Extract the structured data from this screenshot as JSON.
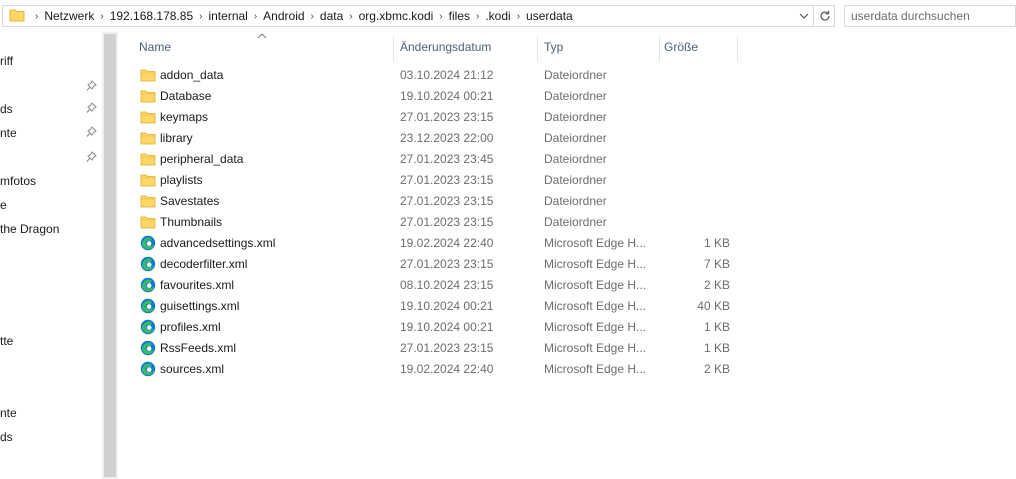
{
  "address_bar": {
    "path": [
      "Netzwerk",
      "192.168.178.85",
      "internal",
      "Android",
      "data",
      "org.xbmc.kodi",
      "files",
      ".kodi",
      "userdata"
    ]
  },
  "search": {
    "placeholder": "userdata durchsuchen"
  },
  "nav_pane": {
    "items": [
      {
        "label": "riff",
        "pinned": false
      },
      {
        "label": "",
        "pinned": true
      },
      {
        "label": "ds",
        "pinned": true
      },
      {
        "label": "nte",
        "pinned": true
      },
      {
        "label": "",
        "pinned": true
      },
      {
        "label": "mfotos",
        "pinned": false
      },
      {
        "label": "e",
        "pinned": false
      },
      {
        "label": "the Dragon",
        "pinned": false
      },
      {
        "label": "tte",
        "pinned": false
      },
      {
        "label": "nte",
        "pinned": false
      },
      {
        "label": "ds",
        "pinned": false
      }
    ]
  },
  "columns": {
    "name": "Name",
    "date": "Änderungsdatum",
    "type": "Typ",
    "size": "Größe",
    "sorted_by": "name"
  },
  "files": [
    {
      "name": "addon_data",
      "date": "03.10.2024 21:12",
      "type": "Dateiordner",
      "size": "",
      "icon": "folder-icon"
    },
    {
      "name": "Database",
      "date": "19.10.2024 00:21",
      "type": "Dateiordner",
      "size": "",
      "icon": "folder-icon"
    },
    {
      "name": "keymaps",
      "date": "27.01.2023 23:15",
      "type": "Dateiordner",
      "size": "",
      "icon": "folder-icon"
    },
    {
      "name": "library",
      "date": "23.12.2023 22:00",
      "type": "Dateiordner",
      "size": "",
      "icon": "folder-icon"
    },
    {
      "name": "peripheral_data",
      "date": "27.01.2023 23:45",
      "type": "Dateiordner",
      "size": "",
      "icon": "folder-icon"
    },
    {
      "name": "playlists",
      "date": "27.01.2023 23:15",
      "type": "Dateiordner",
      "size": "",
      "icon": "folder-icon"
    },
    {
      "name": "Savestates",
      "date": "27.01.2023 23:15",
      "type": "Dateiordner",
      "size": "",
      "icon": "folder-icon"
    },
    {
      "name": "Thumbnails",
      "date": "27.01.2023 23:15",
      "type": "Dateiordner",
      "size": "",
      "icon": "folder-icon"
    },
    {
      "name": "advancedsettings.xml",
      "date": "19.02.2024 22:40",
      "type": "Microsoft Edge H...",
      "size": "1 KB",
      "icon": "edge-icon"
    },
    {
      "name": "decoderfilter.xml",
      "date": "27.01.2023 23:15",
      "type": "Microsoft Edge H...",
      "size": "7 KB",
      "icon": "edge-icon"
    },
    {
      "name": "favourites.xml",
      "date": "08.10.2024 23:15",
      "type": "Microsoft Edge H...",
      "size": "2 KB",
      "icon": "edge-icon"
    },
    {
      "name": "guisettings.xml",
      "date": "19.10.2024 00:21",
      "type": "Microsoft Edge H...",
      "size": "40 KB",
      "icon": "edge-icon"
    },
    {
      "name": "profiles.xml",
      "date": "19.10.2024 00:21",
      "type": "Microsoft Edge H...",
      "size": "1 KB",
      "icon": "edge-icon"
    },
    {
      "name": "RssFeeds.xml",
      "date": "27.01.2023 23:15",
      "type": "Microsoft Edge H...",
      "size": "1 KB",
      "icon": "edge-icon"
    },
    {
      "name": "sources.xml",
      "date": "19.02.2024 22:40",
      "type": "Microsoft Edge H...",
      "size": "2 KB",
      "icon": "edge-icon"
    }
  ],
  "colors": {
    "folder_yellow": "#ffd766",
    "edge_blue": "#0c79d4",
    "edge_green": "#39b76a",
    "header_text": "#4c607a"
  }
}
